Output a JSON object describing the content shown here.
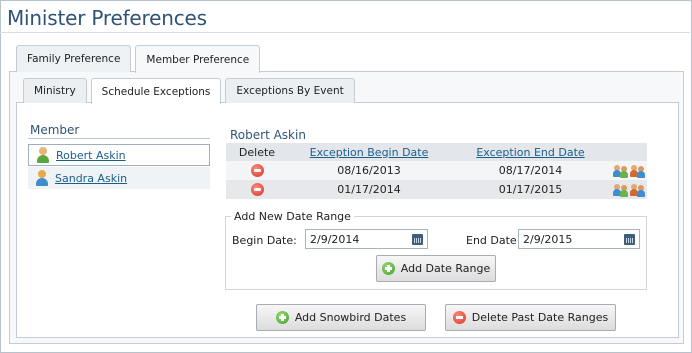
{
  "page": {
    "title": "Minister Preferences"
  },
  "tabs": [
    "Family Preference",
    "Member Preference"
  ],
  "subtabs": [
    "Ministry",
    "Schedule Exceptions",
    "Exceptions By Event"
  ],
  "members": {
    "heading": "Member",
    "items": [
      {
        "name": "Robert Askin",
        "icon": "male-user-icon"
      },
      {
        "name": "Sandra Askin",
        "icon": "female-user-icon"
      }
    ]
  },
  "detail": {
    "name": "Robert Askin",
    "columns": [
      "Delete",
      "Exception Begin Date",
      "Exception End Date"
    ],
    "rows": [
      {
        "begin": "08/16/2013",
        "end": "08/17/2014"
      },
      {
        "begin": "01/17/2014",
        "end": "01/17/2015"
      }
    ]
  },
  "new_range": {
    "legend": "Add New Date Range",
    "begin_label": "Begin Date:",
    "begin_value": "2/9/2014",
    "end_label": "End Date:",
    "end_value": "2/9/2015",
    "add_button": "Add Date Range"
  },
  "actions": {
    "snowbird_button": "Add Snowbird Dates",
    "delete_past_button": "Delete Past Date Ranges"
  },
  "colors": {
    "title": "#2f5476",
    "link": "#1a5e8a",
    "add": "#3f9d2a",
    "delete": "#d8342a"
  }
}
